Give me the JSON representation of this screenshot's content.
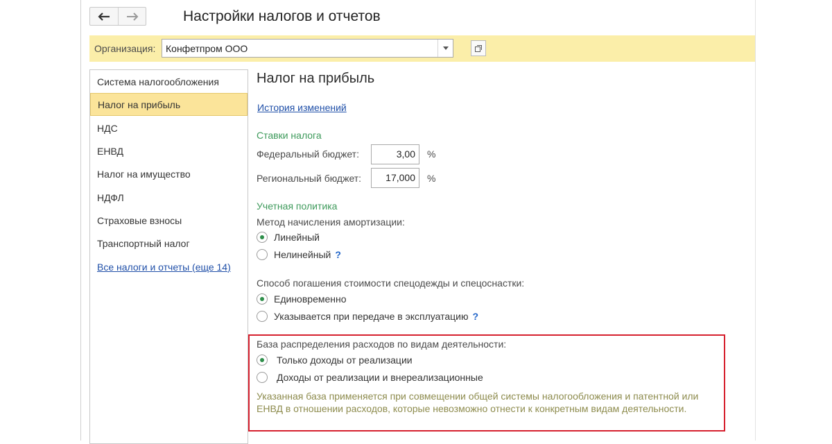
{
  "window": {
    "title": "Настройки налогов и отчетов",
    "back_icon": "arrow-left-icon",
    "forward_icon": "arrow-right-icon"
  },
  "organization": {
    "label": "Организация:",
    "value": "Конфетпром ООО"
  },
  "sidebar": {
    "items": [
      {
        "label": "Система налогообложения",
        "selected": false
      },
      {
        "label": "Налог на прибыль",
        "selected": true
      },
      {
        "label": "НДС",
        "selected": false
      },
      {
        "label": "ЕНВД",
        "selected": false
      },
      {
        "label": "Налог на имущество",
        "selected": false
      },
      {
        "label": "НДФЛ",
        "selected": false
      },
      {
        "label": "Страховые взносы",
        "selected": false
      },
      {
        "label": "Транспортный налог",
        "selected": false
      }
    ],
    "all_link": "Все налоги и отчеты (еще 14)"
  },
  "main": {
    "title": "Налог на прибыль",
    "history_link": "История изменений",
    "rates": {
      "title": "Ставки налога",
      "federal_label": "Федеральный бюджет:",
      "federal_value": "3,00",
      "regional_label": "Региональный бюджет:",
      "regional_value": "17,000",
      "percent": "%"
    },
    "policy": {
      "title": "Учетная политика",
      "depreciation_label": "Метод начисления амортизации:",
      "depreciation_options": [
        "Линейный",
        "Нелинейный"
      ],
      "workwear_label": "Способ погашения стоимости спецодежды и спецоснастки:",
      "workwear_options": [
        "Единовременно",
        "Указывается при передаче в эксплуатацию"
      ],
      "help": "?"
    },
    "base": {
      "label": "База распределения расходов по видам деятельности:",
      "options": [
        "Только доходы от реализации",
        "Доходы от реализации и внереализационные"
      ],
      "note": "Указанная база применяется при совмещении общей системы налогообложения и патентной или ЕНВД в отношении расходов, которые невозможно отнести к конкретным видам деятельности."
    }
  },
  "colors": {
    "accent_yellow": "#fbeea9",
    "selected_row": "#fbe49a",
    "group_green": "#3e9a5b",
    "link_blue": "#1f4fa8",
    "highlight_red": "#d6202e",
    "note_olive": "#8d8b4d"
  }
}
